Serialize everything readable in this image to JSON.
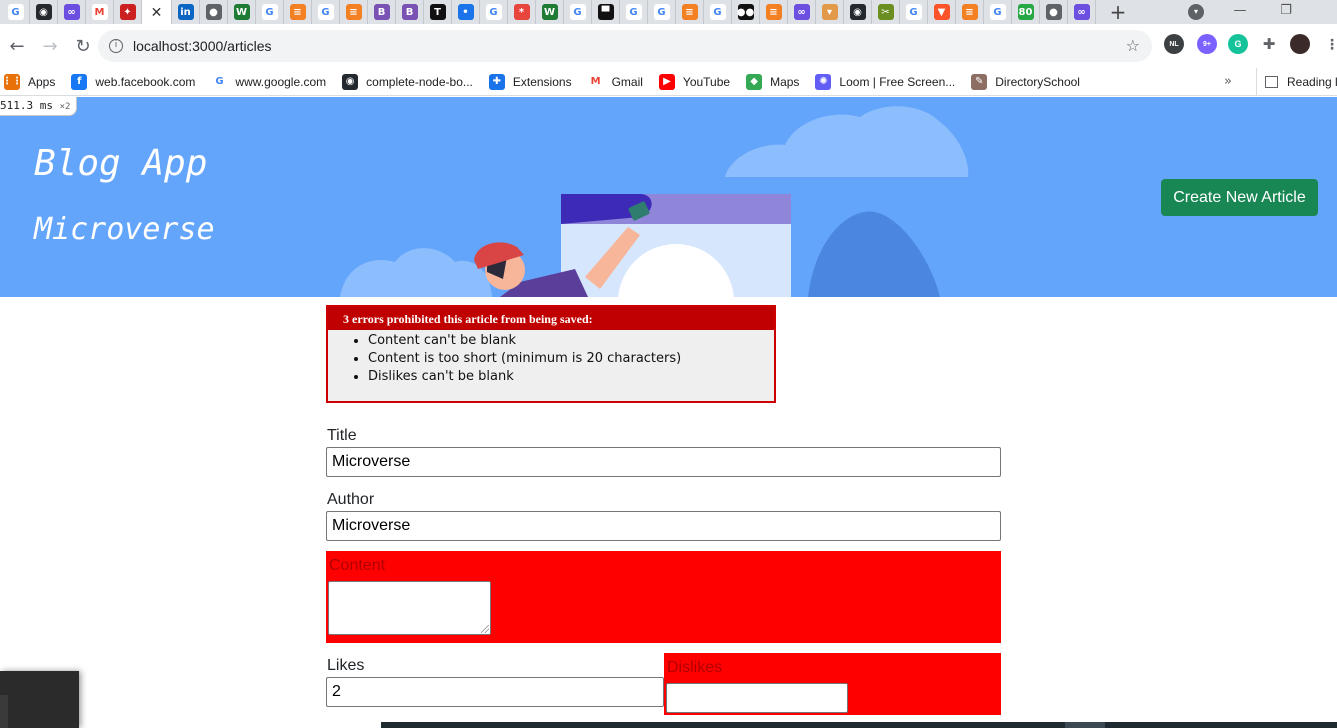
{
  "browser": {
    "tab_icons": [
      "google-icon",
      "github-icon",
      "meta-icon",
      "gmail-icon",
      "app-icon",
      "linkedin-icon",
      "globe-icon",
      "w-icon",
      "google-icon",
      "stack-icon",
      "google-icon",
      "stack-icon",
      "bootstrap-icon",
      "bootstrap-icon",
      "nyt-icon",
      "circle-icon",
      "google-icon",
      "asterisk-icon",
      "w-icon",
      "google-icon",
      "flag-icon",
      "google-icon",
      "google-icon",
      "stack-icon",
      "google-icon",
      "medium-icon",
      "stack-icon",
      "meta-icon",
      "badge-icon",
      "github-icon",
      "tools-icon",
      "google-icon",
      "brave-icon",
      "stack-icon",
      "google-icon",
      "counter-icon",
      "globe-icon",
      "meta-icon"
    ],
    "active_tab_close": "✕",
    "new_tab": "+",
    "minimize": "—",
    "restore": "❐",
    "address": "localhost:3000/articles",
    "extension_badges": {
      "nl": "NL",
      "count": "9+"
    }
  },
  "bookmarks": [
    {
      "label": "Apps",
      "icon": "apps-grid-icon",
      "color": "#e8710a"
    },
    {
      "label": "web.facebook.com",
      "icon": "facebook-icon",
      "color": "#1877f2"
    },
    {
      "label": "www.google.com",
      "icon": "google-icon",
      "color": "#ffffff"
    },
    {
      "label": "complete-node-bo...",
      "icon": "github-icon",
      "color": "#24292f"
    },
    {
      "label": "Extensions",
      "icon": "puzzle-icon",
      "color": "#1a73e8"
    },
    {
      "label": "Gmail",
      "icon": "gmail-icon",
      "color": "#ffffff"
    },
    {
      "label": "YouTube",
      "icon": "youtube-icon",
      "color": "#ff0000"
    },
    {
      "label": "Maps",
      "icon": "maps-icon",
      "color": "#34a853"
    },
    {
      "label": "Loom | Free Screen...",
      "icon": "loom-icon",
      "color": "#625df5"
    },
    {
      "label": "DirectorySchool",
      "icon": "school-icon",
      "color": "#8d6e63"
    }
  ],
  "reading_list": "Reading list",
  "perf_overlay": {
    "value": "511.3",
    "unit": "ms",
    "multiplier": "×2"
  },
  "hero": {
    "title": "Blog App",
    "subtitle": "Microverse",
    "create_button": "Create New Article"
  },
  "errors": {
    "heading": "3 errors prohibited this article from being saved:",
    "items": [
      "Content can't be blank",
      "Content is too short (minimum is 20 characters)",
      "Dislikes can't be blank"
    ]
  },
  "form": {
    "title_label": "Title",
    "title_value": "Microverse",
    "author_label": "Author",
    "author_value": "Microverse",
    "content_label": "Content",
    "likes_label": "Likes",
    "likes_value": "2",
    "dislikes_label": "Dislikes"
  },
  "colors": {
    "hero_bg": "#64a5fc",
    "button_green": "#198754",
    "error_red": "#ff0000",
    "error_header": "#c00000"
  }
}
